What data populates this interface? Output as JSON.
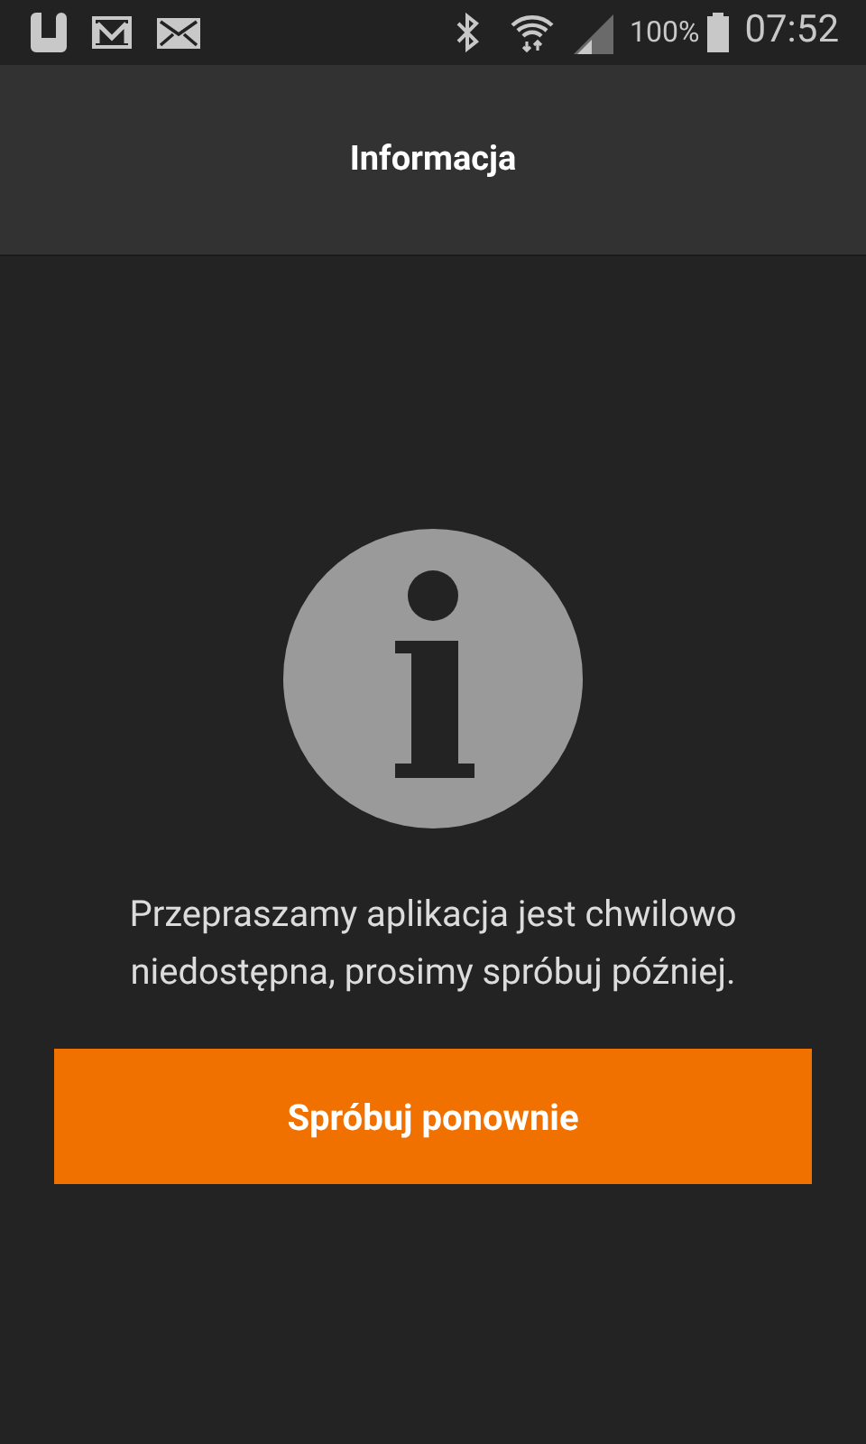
{
  "status_bar": {
    "battery": "100%",
    "time": "07:52"
  },
  "header": {
    "title": "Informacja"
  },
  "message": "Przepraszamy aplikacja jest chwilowo niedostępna, prosimy spróbuj później.",
  "buttons": [
    "Spróbuj ponownie"
  ]
}
